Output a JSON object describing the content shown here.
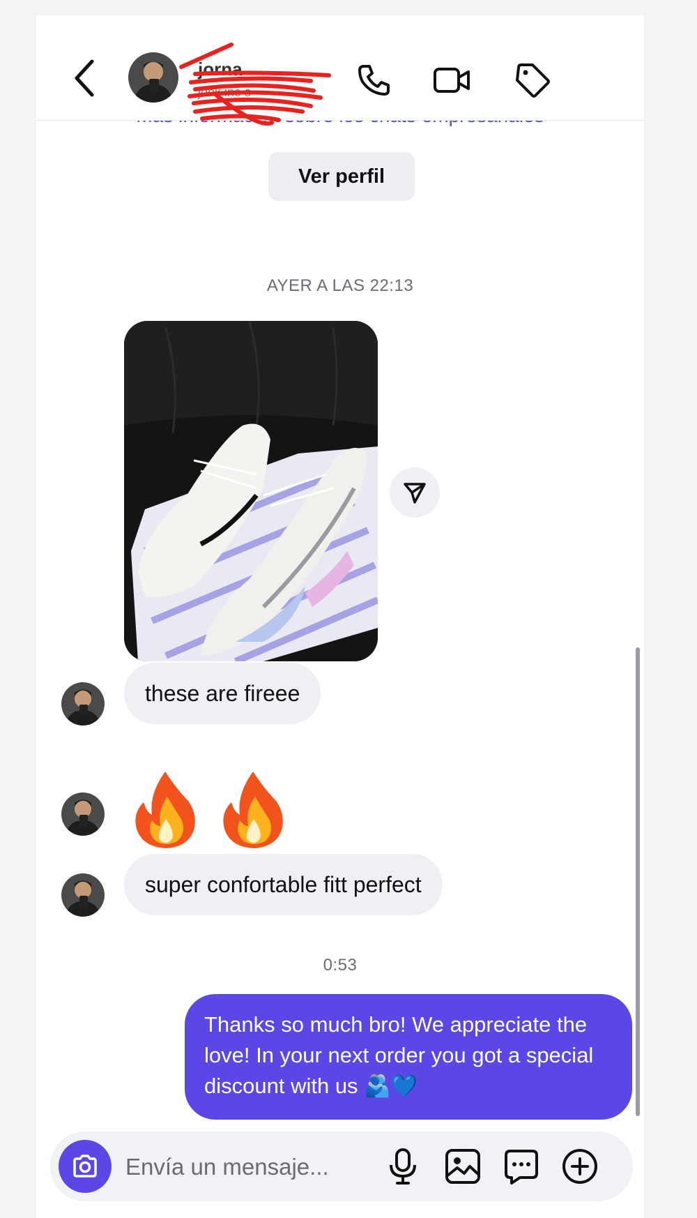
{
  "header": {
    "contact_name": "jorna",
    "contact_subtitle": "jonk ine s",
    "icons": [
      "back-chevron-icon",
      "phone-icon",
      "video-camera-icon",
      "tag-icon"
    ]
  },
  "info_link": "Más información sobre los chats empresariales",
  "profile_button": "Ver perfil",
  "timestamps": {
    "first": "AYER A LAS 22:13",
    "second": "0:53"
  },
  "messages": {
    "incoming_1": "these are fireee",
    "incoming_2_emoji": "🔥🔥",
    "incoming_3": "super confortable fitt perfect",
    "outgoing_1": "Thanks so much bro! We appreciate the love! In your next order you got a special discount with us 🫂💙"
  },
  "composer": {
    "placeholder": "Envía un mensaje...",
    "icons": [
      "camera-icon",
      "microphone-icon",
      "gallery-icon",
      "sticker-chat-icon",
      "plus-icon"
    ]
  },
  "colors": {
    "accent": "#5b46e6",
    "incoming_bubble": "#eef0f4",
    "link": "#4b4fd0"
  }
}
